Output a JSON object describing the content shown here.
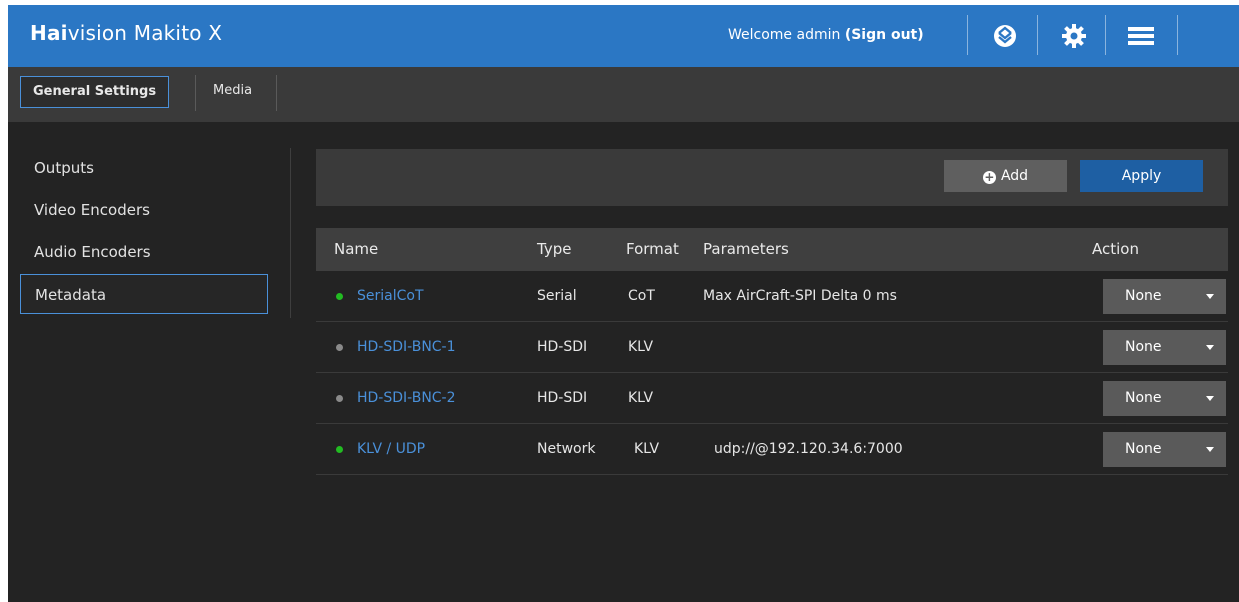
{
  "header": {
    "brand_bold": "Hai",
    "brand_rest": "vision Makito X",
    "welcome_text": "Welcome admin",
    "signout_label": "(Sign out)"
  },
  "tabs": [
    {
      "label": "General Settings",
      "active": true
    },
    {
      "label": "Media",
      "active": false
    }
  ],
  "sidebar": {
    "items": [
      {
        "label": "Outputs",
        "active": false
      },
      {
        "label": "Video Encoders",
        "active": false
      },
      {
        "label": "Audio Encoders",
        "active": false
      },
      {
        "label": "Metadata",
        "active": true
      }
    ]
  },
  "toolbar": {
    "add_label": "Add",
    "apply_label": "Apply"
  },
  "table": {
    "headers": {
      "name": "Name",
      "type": "Type",
      "format": "Format",
      "parameters": "Parameters",
      "action": "Action"
    },
    "rows": [
      {
        "name": "SerialCoT",
        "type": "Serial",
        "format": "CoT",
        "parameters": "Max AirCraft-SPI Delta 0 ms",
        "action": "None",
        "status_color": "#22bb22"
      },
      {
        "name": "HD-SDI-BNC-1",
        "type": "HD-SDI",
        "format": "KLV",
        "parameters": "",
        "action": "None",
        "status_color": "#8a8a8a"
      },
      {
        "name": "HD-SDI-BNC-2",
        "type": "HD-SDI",
        "format": "KLV",
        "parameters": "",
        "action": "None",
        "status_color": "#8a8a8a"
      },
      {
        "name": "KLV / UDP",
        "type": "Network",
        "format": "KLV",
        "parameters": "udp://@192.120.34.6:7000",
        "action": "None",
        "status_color": "#22bb22"
      }
    ]
  },
  "colors": {
    "header_blue": "#2b77c4",
    "accent_blue": "#4a90d9",
    "apply_blue": "#1e5fa3",
    "status_active": "#22bb22",
    "status_inactive": "#8a8a8a"
  },
  "icons": [
    "haivision-logo-icon",
    "gear-icon",
    "hamburger-menu-icon",
    "plus-circle-icon",
    "caret-down-icon",
    "status-dot-icon"
  ]
}
